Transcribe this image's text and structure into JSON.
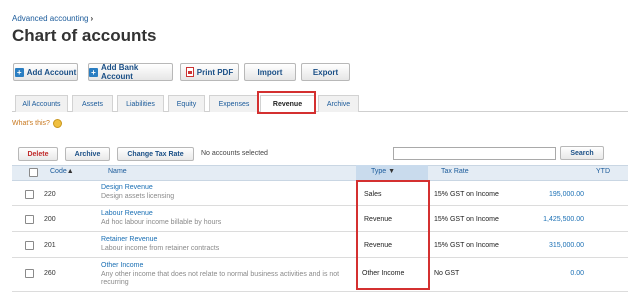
{
  "breadcrumb": {
    "parent": "Advanced accounting",
    "chevron": "›"
  },
  "page_title": "Chart of accounts",
  "toolbar": {
    "add_account": "Add Account",
    "add_bank_account": "Add Bank Account",
    "print_pdf": "Print PDF",
    "import": "Import",
    "export": "Export"
  },
  "tabs": [
    {
      "label": "All Accounts"
    },
    {
      "label": "Assets"
    },
    {
      "label": "Liabilities"
    },
    {
      "label": "Equity"
    },
    {
      "label": "Expenses"
    },
    {
      "label": "Revenue",
      "active": true
    },
    {
      "label": "Archive"
    }
  ],
  "whats_this": "What's this?",
  "actions": {
    "delete": "Delete",
    "archive": "Archive",
    "change_tax_rate": "Change Tax Rate",
    "selection_status": "No accounts selected",
    "search_placeholder": "",
    "search": "Search"
  },
  "table": {
    "columns": {
      "code": "Code",
      "name": "Name",
      "type": "Type",
      "tax_rate": "Tax Rate",
      "ytd": "YTD"
    },
    "code_sort_glyph": "▲",
    "type_sort_glyph": "▼",
    "rows": [
      {
        "code": "220",
        "name": "Design Revenue",
        "description": "Design assets licensing",
        "type": "Sales",
        "tax_rate": "15% GST on Income",
        "ytd": "195,000.00"
      },
      {
        "code": "200",
        "name": "Labour Revenue",
        "description": "Ad hoc labour income billable by hours",
        "type": "Revenue",
        "tax_rate": "15% GST on Income",
        "ytd": "1,425,500.00"
      },
      {
        "code": "201",
        "name": "Retainer Revenue",
        "description": "Labour income from retainer contracts",
        "type": "Revenue",
        "tax_rate": "15% GST on Income",
        "ytd": "315,000.00"
      },
      {
        "code": "260",
        "name": "Other Income",
        "description": "Any other income that does not relate to normal business activities and is not recurring",
        "type": "Other Income",
        "tax_rate": "No GST",
        "ytd": "0.00"
      }
    ]
  },
  "colors": {
    "link": "#1a6fb4",
    "highlight": "#d43030",
    "header_bg": "#e4ecf4"
  }
}
